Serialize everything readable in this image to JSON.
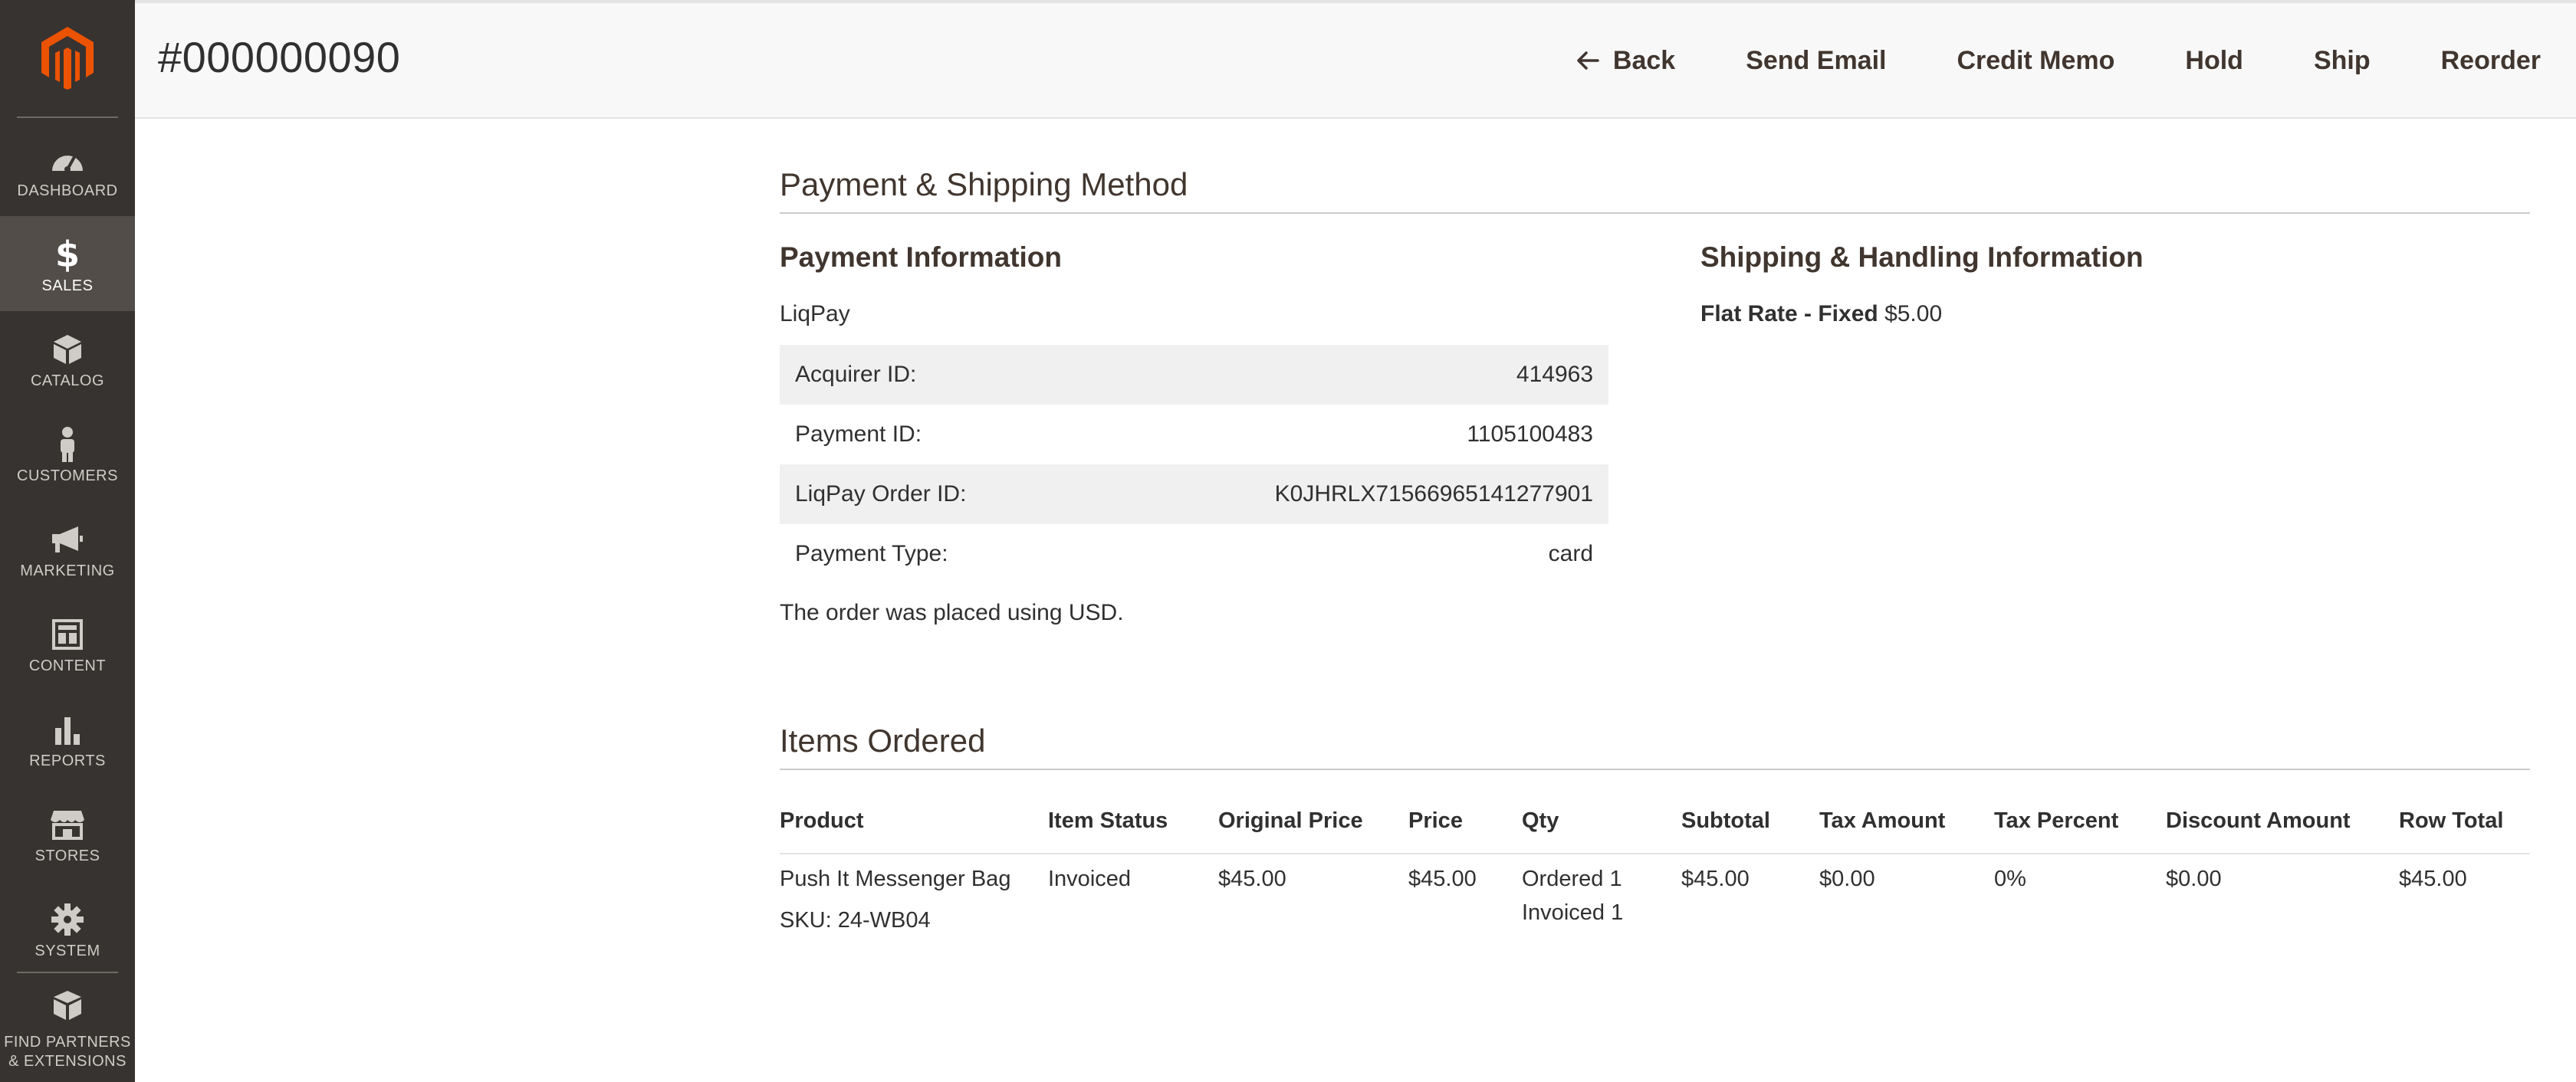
{
  "sidebar": {
    "items": [
      {
        "label": "DASHBOARD",
        "icon": "dashboard-icon"
      },
      {
        "label": "SALES",
        "icon": "dollar-icon",
        "active": true
      },
      {
        "label": "CATALOG",
        "icon": "catalog-box-icon"
      },
      {
        "label": "CUSTOMERS",
        "icon": "customer-person-icon"
      },
      {
        "label": "MARKETING",
        "icon": "megaphone-icon"
      },
      {
        "label": "CONTENT",
        "icon": "content-layout-icon"
      },
      {
        "label": "REPORTS",
        "icon": "bar-chart-icon"
      },
      {
        "label": "STORES",
        "icon": "storefront-icon"
      },
      {
        "label": "SYSTEM",
        "icon": "gear-icon"
      }
    ],
    "extensions": {
      "line1": "FIND PARTNERS",
      "line2": "& EXTENSIONS",
      "icon": "cubes-icon"
    }
  },
  "header": {
    "title": "#000000090",
    "actions": {
      "back": "Back",
      "send_email": "Send Email",
      "credit_memo": "Credit Memo",
      "hold": "Hold",
      "ship": "Ship",
      "reorder": "Reorder"
    }
  },
  "payment_shipping": {
    "section_title": "Payment & Shipping Method",
    "payment": {
      "title": "Payment Information",
      "method": "LiqPay",
      "rows": [
        {
          "label": "Acquirer ID:",
          "value": "414963"
        },
        {
          "label": "Payment ID:",
          "value": "1105100483"
        },
        {
          "label": "LiqPay Order ID:",
          "value": "K0JHRLX71566965141277901"
        },
        {
          "label": "Payment Type:",
          "value": "card"
        }
      ],
      "currency_note": "The order was placed using USD."
    },
    "shipping": {
      "title": "Shipping & Handling Information",
      "method": "Flat Rate - Fixed",
      "price": "$5.00"
    }
  },
  "items_ordered": {
    "section_title": "Items Ordered",
    "headers": {
      "product": "Product",
      "item_status": "Item Status",
      "original_price": "Original Price",
      "price": "Price",
      "qty": "Qty",
      "subtotal": "Subtotal",
      "tax_amount": "Tax Amount",
      "tax_percent": "Tax Percent",
      "discount_amount": "Discount Amount",
      "row_total": "Row Total"
    },
    "rows": [
      {
        "product": "Push It Messenger Bag",
        "sku": "SKU: 24-WB04",
        "item_status": "Invoiced",
        "original_price": "$45.00",
        "price": "$45.00",
        "qty_ordered": "Ordered 1",
        "qty_invoiced": "Invoiced 1",
        "subtotal": "$45.00",
        "tax_amount": "$0.00",
        "tax_percent": "0%",
        "discount_amount": "$0.00",
        "row_total": "$45.00"
      }
    ]
  },
  "colors": {
    "sidebar_bg": "#373330",
    "sidebar_active": "#524d49",
    "brand_orange": "#eb5202",
    "header_bg": "#f8f8f8"
  }
}
